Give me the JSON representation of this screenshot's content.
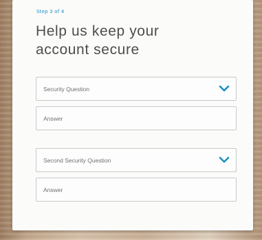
{
  "form": {
    "step": "Step 3 of 4",
    "heading_line1": "Help us keep your",
    "heading_line2": "account secure",
    "question1_placeholder": "Security Question",
    "answer1_placeholder": "Answer",
    "question2_placeholder": "Second Security Question",
    "answer2_placeholder": "Answer"
  },
  "icons": {
    "dropdown": "chevron-down-icon"
  },
  "colors": {
    "accent": "#1d8fc4",
    "heading": "#4d4d4d",
    "border": "#c9c9c9"
  }
}
